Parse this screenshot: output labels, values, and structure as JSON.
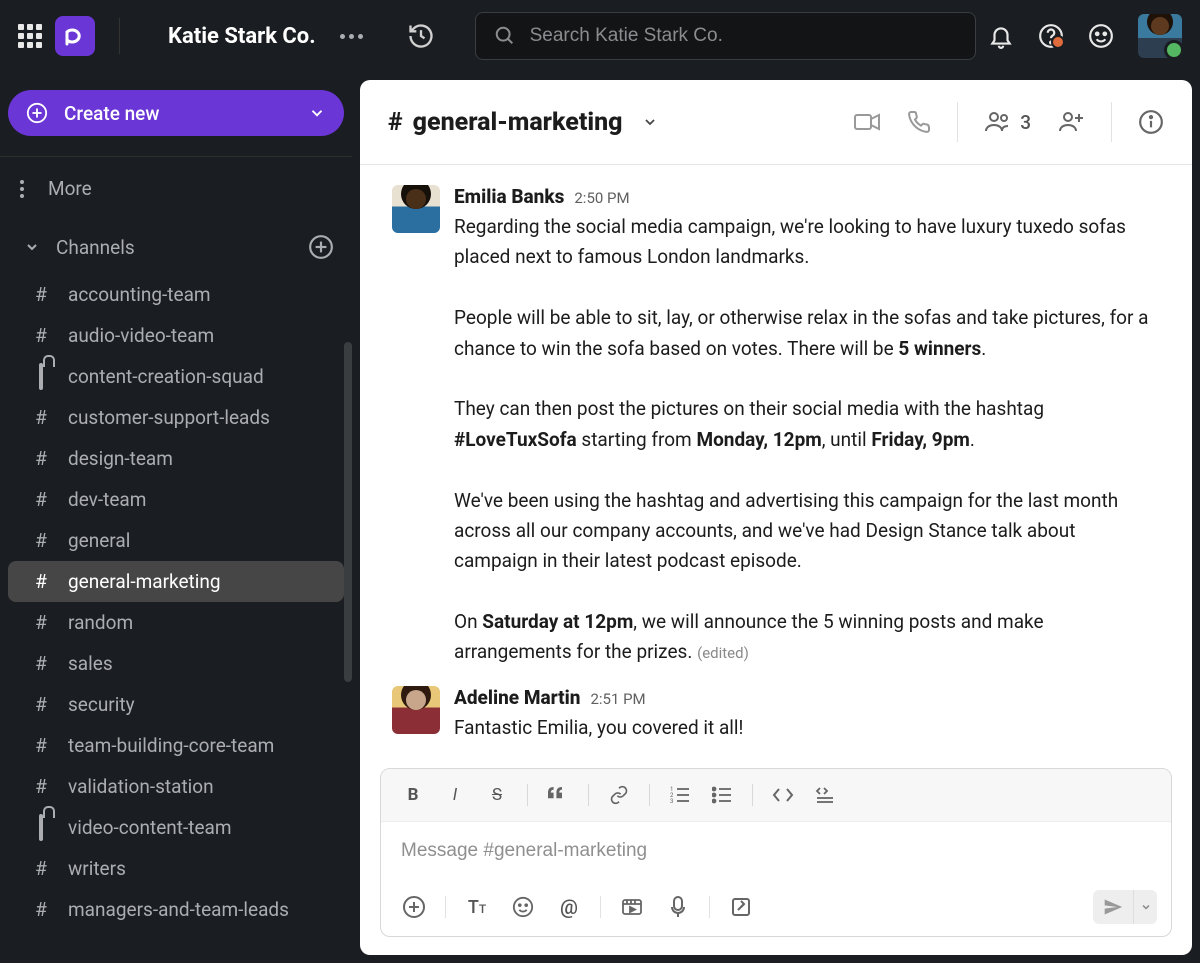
{
  "workspace": {
    "name": "Katie Stark Co."
  },
  "search": {
    "placeholder": "Search Katie Stark Co."
  },
  "sidebar": {
    "create_label": "Create new",
    "more_label": "More",
    "channels_label": "Channels",
    "channels": [
      {
        "name": "accounting-team",
        "locked": false
      },
      {
        "name": "audio-video-team",
        "locked": false
      },
      {
        "name": "content-creation-squad",
        "locked": true
      },
      {
        "name": "customer-support-leads",
        "locked": false
      },
      {
        "name": "design-team",
        "locked": false
      },
      {
        "name": "dev-team",
        "locked": false
      },
      {
        "name": "general",
        "locked": false
      },
      {
        "name": "general-marketing",
        "locked": false,
        "active": true
      },
      {
        "name": "random",
        "locked": false
      },
      {
        "name": "sales",
        "locked": false
      },
      {
        "name": "security",
        "locked": false
      },
      {
        "name": "team-building-core-team",
        "locked": false
      },
      {
        "name": "validation-station",
        "locked": false
      },
      {
        "name": "video-content-team",
        "locked": true
      },
      {
        "name": "writers",
        "locked": false
      },
      {
        "name": "managers-and-team-leads",
        "locked": false
      }
    ]
  },
  "channel": {
    "hash": "#",
    "name": "general-marketing",
    "people_count": "3"
  },
  "messages": [
    {
      "author": "Emilia Banks",
      "time": "2:50 PM",
      "body_html": "Regarding the social media campaign, we're looking to have luxury tuxedo sofas placed next to famous London landmarks.<br><br>People will be able to sit, lay, or otherwise relax in the sofas and take pictures, for a chance to win the sofa based on votes. There will be <b>5 winners</b>.<br><br>They can then post the pictures on their social media with the hashtag <b>#LoveTuxSofa</b> starting from <b>Monday, 12pm</b>, until <b>Friday, 9pm</b>.<br><br>We've been using the hashtag and advertising this campaign for the last month across all our company accounts, and we've had Design Stance talk about campaign in their latest podcast episode.<br><br>On <b>Saturday at 12pm</b>, we will announce the 5 winning posts and make arrangements for the prizes. <span class='edited'>(edited)</span>"
    },
    {
      "author": "Adeline Martin",
      "time": "2:51 PM",
      "body_html": "Fantastic Emilia, you covered it all!"
    }
  ],
  "composer": {
    "placeholder": "Message #general-marketing"
  }
}
